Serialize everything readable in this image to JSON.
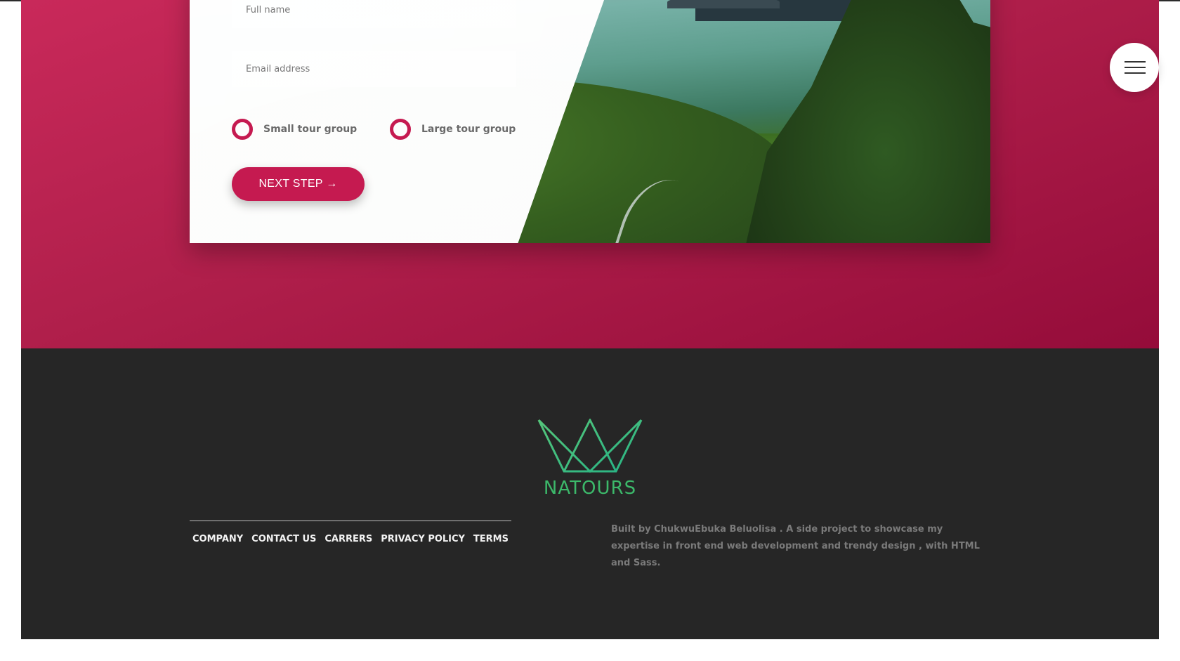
{
  "booking": {
    "name_placeholder": "Full name",
    "email_placeholder": "Email address",
    "radio_small_label": "Small tour group",
    "radio_large_label": "Large tour group",
    "next_button_label": "NEXT STEP →"
  },
  "menu": {
    "icon": "hamburger-menu-icon"
  },
  "footer": {
    "logo_text": "NATOURS",
    "nav": [
      {
        "label": "COMPANY"
      },
      {
        "label": "CONTACT US"
      },
      {
        "label": "CARRERS"
      },
      {
        "label": "PRIVACY POLICY"
      },
      {
        "label": "TERMS"
      }
    ],
    "credit": "Built by ChukwuEbuka Beluolisa . A side project to showcase my expertise in front end web development and trendy design , with HTML and Sass."
  },
  "colors": {
    "accent": "#c51a50",
    "footer_bg": "#262626",
    "logo_green": "#3cb86a"
  }
}
